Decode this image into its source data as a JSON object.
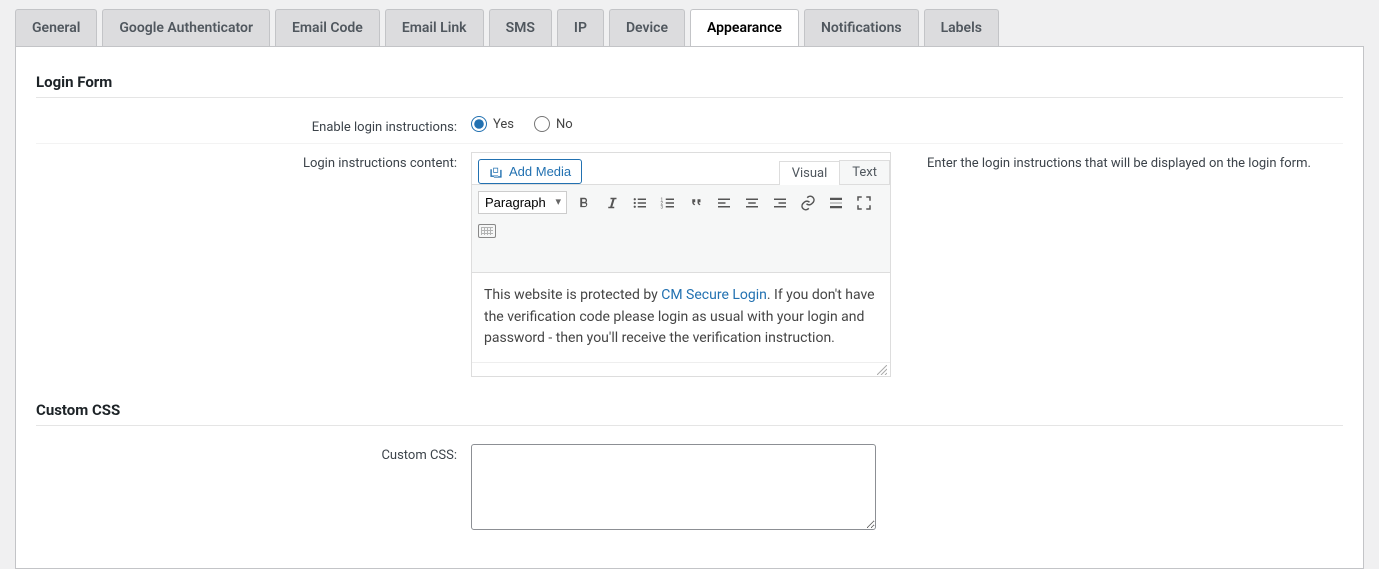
{
  "tabs": [
    "General",
    "Google Authenticator",
    "Email Code",
    "Email Link",
    "SMS",
    "IP",
    "Device",
    "Appearance",
    "Notifications",
    "Labels"
  ],
  "active_tab": 7,
  "sections": {
    "login_form": {
      "title": "Login Form"
    },
    "custom_css": {
      "title": "Custom CSS"
    }
  },
  "fields": {
    "enable_instructions": {
      "label": "Enable login instructions:",
      "options": {
        "yes": "Yes",
        "no": "No"
      },
      "value": "yes"
    },
    "instructions_content": {
      "label": "Login instructions content:",
      "add_media": "Add Media",
      "editor_tabs": {
        "visual": "Visual",
        "text": "Text",
        "active": "visual"
      },
      "block_format": "Paragraph",
      "content_prefix": "This website is protected by ",
      "content_link": "CM Secure Login",
      "content_suffix": ". If you don't have the verification code please login as usual with your login and password - then you'll receive the verification instruction.",
      "help": "Enter the login instructions that will be displayed on the login form."
    },
    "custom_css": {
      "label": "Custom CSS:",
      "value": ""
    }
  }
}
